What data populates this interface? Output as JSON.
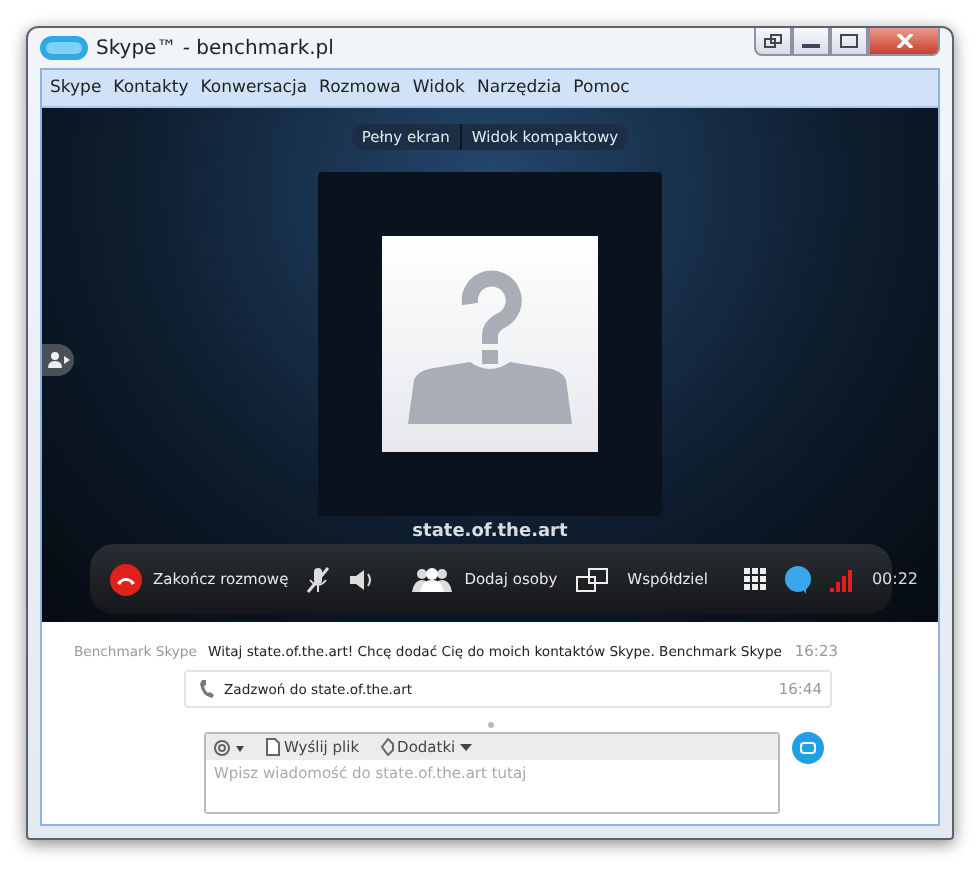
{
  "window": {
    "title": "Skype™ - benchmark.pl"
  },
  "menu": [
    "Skype",
    "Kontakty",
    "Konwersacja",
    "Rozmowa",
    "Widok",
    "Narzędzia",
    "Pomoc"
  ],
  "view_buttons": [
    "Pełny ekran",
    "Widok kompaktowy"
  ],
  "contact": {
    "name": "state.of.the.art"
  },
  "call_bar": {
    "end_call": "Zakończ rozmowę",
    "microphone_muted": true,
    "add_people": "Dodaj osoby",
    "share": "Współdziel",
    "duration": "00:22"
  },
  "messages": [
    {
      "kind": "text",
      "sender": "Benchmark Skype",
      "text": "Witaj state.of.the.art! Chcę dodać Cię do moich kontaktów Skype. Benchmark Skype",
      "time": "16:23"
    },
    {
      "kind": "call",
      "text": "Zadzwoń do state.of.the.art",
      "time": "16:44"
    }
  ],
  "compose": {
    "send_file": "Wyślij plik",
    "extras": "Dodatki",
    "placeholder": "Wpisz wiadomość do state.of.the.art tutaj"
  }
}
